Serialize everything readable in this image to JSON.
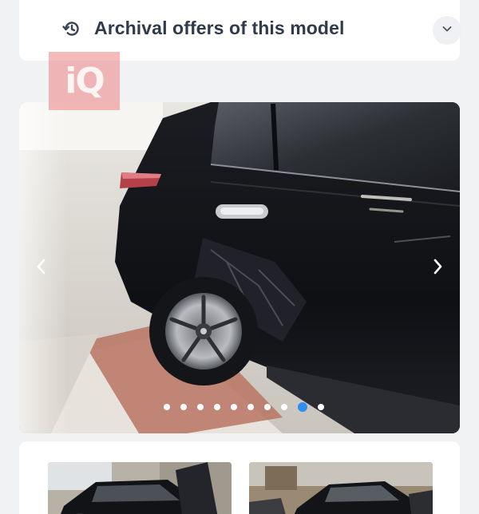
{
  "header": {
    "title": "Archival offers of this model",
    "history_icon": "history-icon",
    "toggle_icon": "chevron-down-icon"
  },
  "watermark": {
    "text": "iQ"
  },
  "gallery": {
    "prev_icon": "chevron-left-icon",
    "next_icon": "chevron-right-icon",
    "image_count": 10,
    "active_index": 8,
    "accent_color": "#2e8ff0"
  },
  "thumbnails": [
    {
      "name": "thumbnail-1"
    },
    {
      "name": "thumbnail-2"
    }
  ]
}
